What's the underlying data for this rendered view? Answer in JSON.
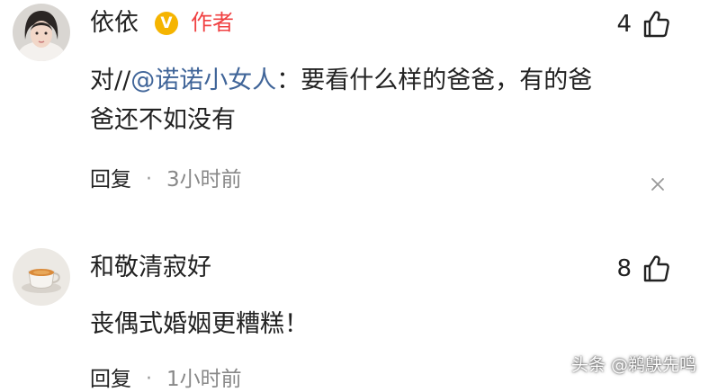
{
  "comments": [
    {
      "avatar": "woman-portrait-avatar",
      "username": "依依",
      "verified_icon": "v-verified-icon",
      "badge": "作者",
      "likes": "4",
      "text_prefix": "对//",
      "mention": "@诺诺小女人",
      "text_line1_rest": "：要看什么样的爸爸，有的爸",
      "text_line2": "爸还不如没有",
      "reply_label": "回复",
      "separator": "·",
      "time": "3小时前",
      "close_icon": "close-icon"
    },
    {
      "avatar": "tea-cup-avatar",
      "username": "和敬清寂好",
      "likes": "8",
      "text": "丧偶式婚姻更糟糕！",
      "reply_label": "回复",
      "separator": "·",
      "time": "1小时前"
    }
  ],
  "watermark": "头条 @鹈鴃先鸣",
  "colors": {
    "background": "#ffffff",
    "text": "#222222",
    "mention": "#406599",
    "author_badge": "#f04142",
    "verified": "#f5b400",
    "meta": "#888888"
  }
}
